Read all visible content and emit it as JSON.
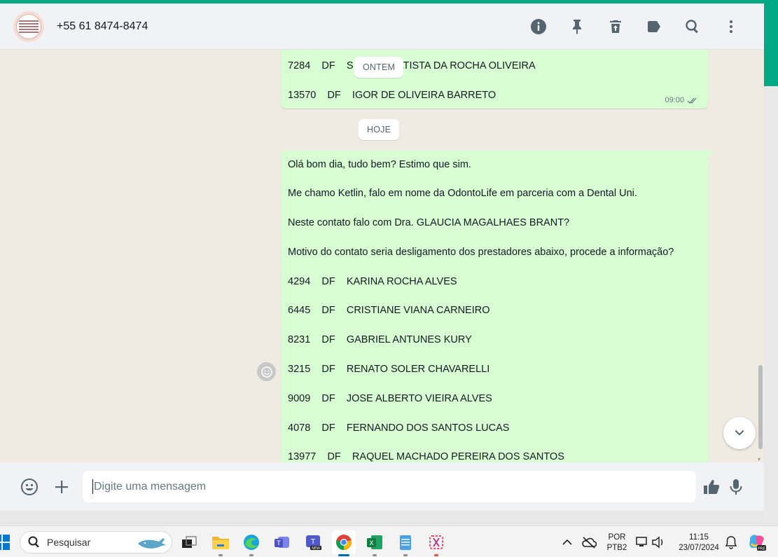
{
  "header": {
    "contact_name": "+55 61 8474-8474",
    "icons": [
      "info-icon",
      "pin-icon",
      "delete-icon",
      "label-icon",
      "search-icon",
      "menu-icon"
    ]
  },
  "chat": {
    "date_yesterday": "ONTEM",
    "date_today": "HOJE",
    "prev_message": {
      "rows": [
        {
          "code": "7284",
          "uf": "DF",
          "name": "S",
          "name_tail": "ERTO BATISTA DA ROCHA OLIVEIRA"
        },
        {
          "code": "13570",
          "uf": "DF",
          "name": "IGOR DE OLIVEIRA BARRETO"
        }
      ],
      "time": "09:00"
    },
    "today_message": {
      "paragraphs": [
        "Olá bom dia, tudo bem? Estimo que sim.",
        "Me chamo Ketlin, falo em nome da OdontoLife em parceria com a Dental Uni.",
        "Neste contato falo com Dra. GLAUCIA MAGALHAES BRANT?",
        "Motivo do contato seria desligamento dos prestadores abaixo, procede a informação?"
      ],
      "rows": [
        {
          "code": "4294",
          "uf": "DF",
          "name": "KARINA ROCHA ALVES"
        },
        {
          "code": "6445",
          "uf": "DF",
          "name": "CRISTIANE VIANA CARNEIRO"
        },
        {
          "code": "8231",
          "uf": "DF",
          "name": "GABRIEL ANTUNES KURY"
        },
        {
          "code": "3215",
          "uf": "DF",
          "name": "RENATO SOLER CHAVARELLI"
        },
        {
          "code": "9009",
          "uf": "DF",
          "name": "JOSE ALBERTO VIEIRA ALVES"
        },
        {
          "code": "4078",
          "uf": "DF",
          "name": "FERNANDO DOS SANTOS LUCAS"
        },
        {
          "code": "13977",
          "uf": "DF",
          "name": "RAQUEL MACHADO PEREIRA DOS SANTOS"
        }
      ]
    }
  },
  "composer": {
    "placeholder": "Digite uma mensagem"
  },
  "taskbar": {
    "search_label": "Pesquisar",
    "lang_line1": "POR",
    "lang_line2": "PTB2",
    "time": "11:15",
    "date": "23/07/2024",
    "colors": {
      "accent": "#0067c0",
      "whatsapp_green": "#00a884",
      "bubble_green": "#d9fdd3"
    }
  }
}
